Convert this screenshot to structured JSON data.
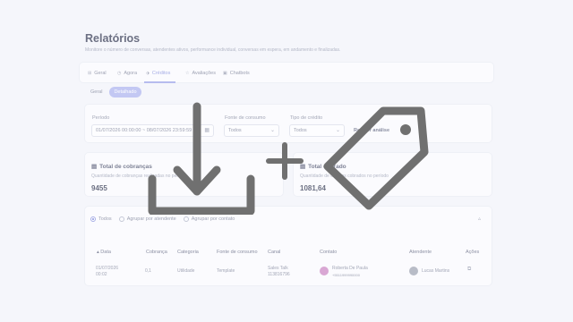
{
  "header": {
    "title": "Relatórios",
    "subtitle": "Monitore o número de conversas, atendentes ativos, performance individual, conversas em espera, em andamento e finalizadas."
  },
  "tabs": [
    {
      "label": "Geral",
      "icon": "grid-icon"
    },
    {
      "label": "Agora",
      "icon": "clock-icon"
    },
    {
      "label": "Créditos",
      "icon": "tag-icon",
      "active": true
    },
    {
      "label": "Avaliações",
      "icon": "star-icon"
    },
    {
      "label": "Chatbots",
      "icon": "bot-icon"
    }
  ],
  "subtabs": [
    {
      "label": "Geral"
    },
    {
      "label": "Detalhado",
      "active": true
    }
  ],
  "filters": {
    "period": {
      "label": "Período",
      "value": "01/07/2026 00:00:00 ~ 08/07/2026 23:59:59"
    },
    "source": {
      "label": "Fonte de consumo",
      "value": "Todos"
    },
    "type": {
      "label": "Tipo de crédito",
      "value": "Todos"
    },
    "refresh_label": "Refazer análise"
  },
  "stats": [
    {
      "title": "Total de cobranças",
      "desc": "Quantidade de cobranças realizadas no período",
      "value": "9455"
    },
    {
      "title": "Total cobrado",
      "desc": "Quantidade de créditos cobrados no período",
      "value": "1081,64"
    }
  ],
  "grouping": {
    "options": [
      "Todos",
      "Agrupar por atendente",
      "Agrupar por contato"
    ],
    "selected": "Todos"
  },
  "table": {
    "columns": [
      "Data",
      "Cobrança",
      "Categoria",
      "Fonte de consumo",
      "Canal",
      "Contato",
      "Atendente",
      "Ações"
    ],
    "rows": [
      {
        "date": "01/07/2026",
        "time": "00:02",
        "charge": "0,1",
        "category": "Utilidade",
        "source": "Template",
        "channel": "Sales Talk",
        "channel_id": "113816796",
        "contact_name": "Roberta De Paula",
        "contact_phone": "+5511999990000",
        "agent": "Lucas Martins"
      }
    ]
  },
  "overlay": {
    "icons": [
      "download-icon",
      "plus-icon",
      "tag-icon"
    ]
  },
  "colors": {
    "accent": "#a7aee6",
    "overlay": "#707070",
    "background": "#f5f6fb"
  }
}
